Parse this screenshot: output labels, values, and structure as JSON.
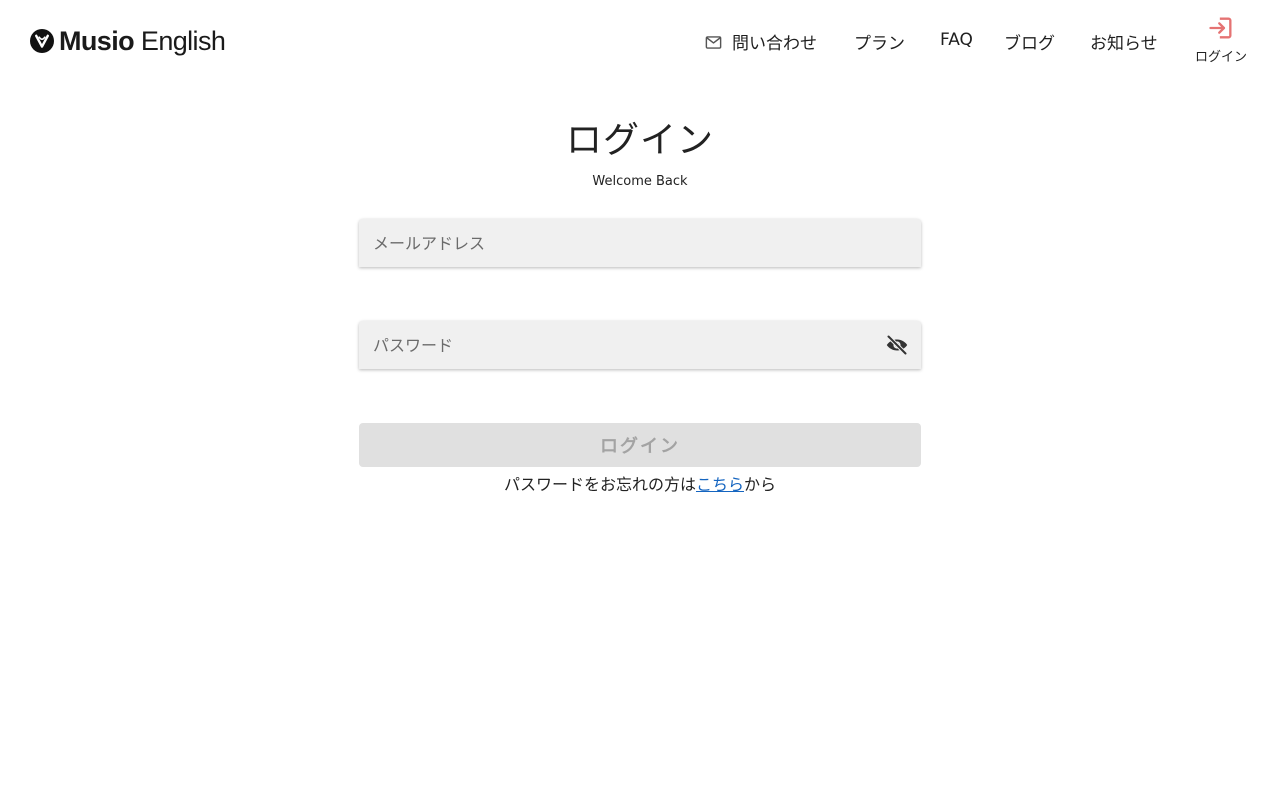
{
  "brand": {
    "name_part1": "Musio",
    "name_part2": "English"
  },
  "nav": {
    "contact": "問い合わせ",
    "plan": "プラン",
    "faq": "FAQ",
    "blog": "ブログ",
    "news": "お知らせ",
    "login": "ログイン"
  },
  "icons": {
    "contact": "mail-icon",
    "login": "login-arrow-icon",
    "password_toggle": "eye-off-icon"
  },
  "colors": {
    "login_icon": "#e57373",
    "link": "#1565c0",
    "field_bg": "#f0f0f0",
    "button_disabled_bg": "#e0e0e0",
    "button_disabled_text": "#a3a3a3"
  },
  "form": {
    "title": "ログイン",
    "subtitle": "Welcome Back",
    "email_placeholder": "メールアドレス",
    "email_value": "",
    "password_placeholder": "パスワード",
    "password_value": "",
    "submit_label": "ログイン",
    "forgot_prefix": "パスワードをお忘れの方は",
    "forgot_link": "こちら",
    "forgot_suffix": "から"
  }
}
